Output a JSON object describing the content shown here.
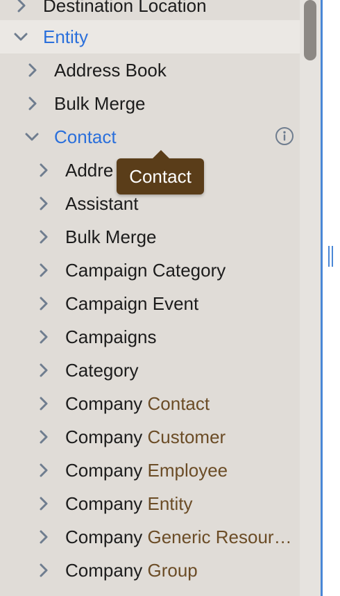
{
  "colors": {
    "panel_bg": "#e0dcd7",
    "active_blue": "#2a6fdb",
    "accent_brown": "#6b4c26",
    "tooltip_bg": "#5a3d19",
    "divider_blue": "#4a87d6"
  },
  "tree": {
    "top_item": {
      "label": "Destination Location",
      "icon": "chevron-right-icon"
    },
    "entity": {
      "label": "Entity",
      "icon": "chevron-down-icon",
      "expanded": true
    },
    "address_book": {
      "label": "Address Book",
      "icon": "chevron-right-icon"
    },
    "bulk_merge": {
      "label": "Bulk Merge",
      "icon": "chevron-right-icon"
    },
    "contact": {
      "label": "Contact",
      "icon": "chevron-down-icon",
      "expanded": true,
      "info_icon": "info-icon"
    },
    "contact_children": [
      {
        "prefix": "Addre",
        "accent": ""
      },
      {
        "prefix": "Assistant",
        "accent": ""
      },
      {
        "prefix": "Bulk Merge",
        "accent": ""
      },
      {
        "prefix": "Campaign Category",
        "accent": ""
      },
      {
        "prefix": "Campaign Event",
        "accent": ""
      },
      {
        "prefix": "Campaigns",
        "accent": ""
      },
      {
        "prefix": "Category",
        "accent": ""
      },
      {
        "prefix": "Company ",
        "accent": "Contact"
      },
      {
        "prefix": "Company ",
        "accent": "Customer"
      },
      {
        "prefix": "Company ",
        "accent": "Employee"
      },
      {
        "prefix": "Company ",
        "accent": "Entity"
      },
      {
        "prefix": "Company ",
        "accent": "Generic Resour…"
      },
      {
        "prefix": "Company ",
        "accent": "Group"
      }
    ]
  },
  "tooltip": {
    "text": "Contact"
  }
}
